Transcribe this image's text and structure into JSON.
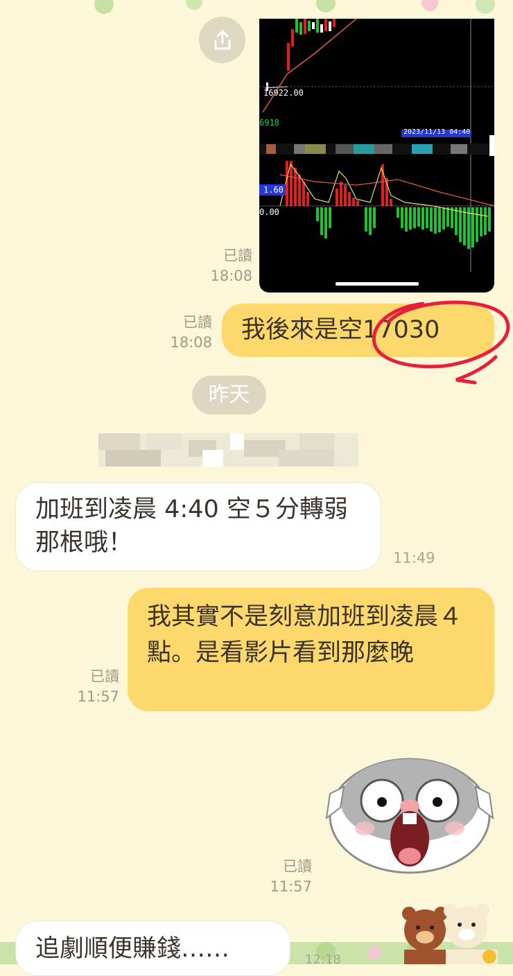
{
  "chart": {
    "price_label": "16922.00",
    "volume_label": "6918",
    "datetime_label": "2023/11/13 04:40",
    "indicator_label": "1.60",
    "zero_label": "0.00",
    "colors": {
      "up": "#e02020",
      "down": "#22c033",
      "ma": "#e2603a",
      "line": "#e8e070",
      "badge": "#2438d8"
    }
  },
  "messages": [
    {
      "read": "已讀",
      "time": "18:08"
    },
    {
      "read": "已讀",
      "time": "18:08",
      "text": "我後來是空17030"
    },
    {
      "text": "加班到凌晨 4:40 空５分轉弱那根哦！",
      "time": "11:49"
    },
    {
      "read": "已讀",
      "time": "11:57",
      "text": "我其實不是刻意加班到凌晨４點。是看影片看到那麼晚"
    },
    {
      "read": "已讀",
      "time": "11:57"
    },
    {
      "text": "追劇順便賺錢……"
    }
  ],
  "date_divider": "昨天",
  "sticker": "hamster-sticker",
  "bottom_time": "12:18",
  "icons": {
    "share": "share-icon",
    "bottom_stickers": "bear-stickers-icon"
  }
}
